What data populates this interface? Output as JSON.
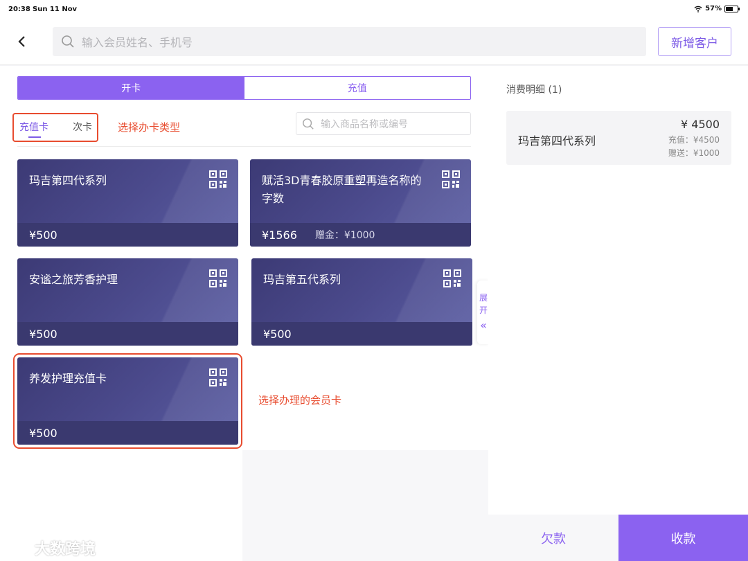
{
  "status": {
    "time": "20:38",
    "date": "Sun 11 Nov",
    "battery": "57%"
  },
  "topbar": {
    "search_placeholder": "输入会员姓名、手机号",
    "add_customer": "新增客户"
  },
  "left": {
    "tabs": [
      "开卡",
      "充值"
    ],
    "type_tabs": [
      "充值卡",
      "次卡"
    ],
    "annotation_type": "选择办卡类型",
    "annotation_card": "选择办理的会员卡",
    "goods_search_placeholder": "输入商品名称或编号",
    "cards": [
      {
        "name": "玛吉第四代系列",
        "price": "¥500",
        "bonus": ""
      },
      {
        "name": "赋活3D青春胶原重塑再造名称的字数",
        "price": "¥1566",
        "bonus": "赠金：¥1000"
      },
      {
        "name": "安谧之旅芳香护理",
        "price": "¥500",
        "bonus": ""
      },
      {
        "name": "玛吉第五代系列",
        "price": "¥500",
        "bonus": ""
      },
      {
        "name": "养发护理充值卡",
        "price": "¥500",
        "bonus": ""
      }
    ],
    "expand_label": "展开",
    "expand_icon": "«"
  },
  "right": {
    "title": "消费明细 (1)",
    "item": {
      "name": "玛吉第四代系列",
      "price": "¥ 4500",
      "recharge": "充值：¥4500",
      "gift": "赠送：¥1000"
    },
    "debt_button": "欠款",
    "collect_button": "收款"
  },
  "watermark": "大数跨境"
}
